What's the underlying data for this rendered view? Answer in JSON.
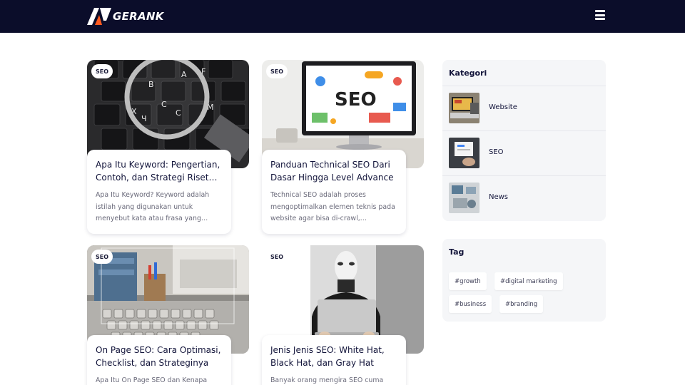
{
  "brand": {
    "name": "GERANK",
    "accent": "#ff5a1f",
    "navy": "#0b0d2a"
  },
  "header": {
    "menu_icon": "hamburger-icon"
  },
  "posts": [
    {
      "category": "SEO",
      "title": "Apa Itu Keyword: Pengertian, Contoh, dan Strategi Riset…",
      "excerpt": "Apa Itu Keyword? Keyword adalah istilah yang digunakan untuk menyebut kata atau frasa yang…"
    },
    {
      "category": "SEO",
      "title": "Panduan Technical SEO Dari Dasar Hingga Level Advance",
      "excerpt": "Technical SEO adalah proses mengoptimalkan elemen teknis pada website agar bisa di-crawl,…"
    },
    {
      "category": "SEO",
      "title": "On Page SEO: Cara Optimasi, Checklist, dan Strateginya",
      "excerpt": "Apa Itu On Page SEO dan Kenapa"
    },
    {
      "category": "SEO",
      "title": "Jenis Jenis SEO: White Hat, Black Hat, dan Gray Hat",
      "excerpt": "Banyak orang mengira SEO cuma"
    }
  ],
  "sidebar": {
    "categories_title": "Kategori",
    "categories": [
      {
        "label": "Website"
      },
      {
        "label": "SEO"
      },
      {
        "label": "News"
      }
    ],
    "tags_title": "Tag",
    "tags": [
      "#growth",
      "#digital marketing",
      "#business",
      "#branding"
    ]
  }
}
